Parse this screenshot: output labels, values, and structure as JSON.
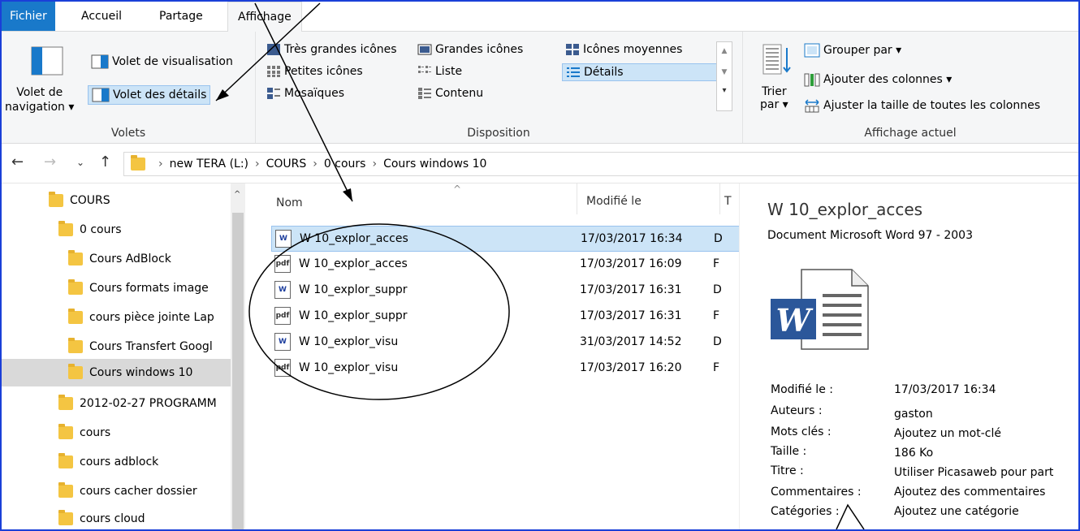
{
  "ribbon_tabs": [
    "Fichier",
    "Accueil",
    "Partage",
    "Affichage"
  ],
  "volets": {
    "nav_pane_line1": "Volet de",
    "nav_pane_line2": "navigation",
    "preview_pane": "Volet de visualisation",
    "details_pane": "Volet des détails",
    "group_label": "Volets"
  },
  "disposition": {
    "items": [
      "Très grandes icônes",
      "Grandes icônes",
      "Icônes moyennes",
      "Petites icônes",
      "Liste",
      "Détails",
      "Mosaïques",
      "Contenu"
    ],
    "group_label": "Disposition"
  },
  "affichage_actuel": {
    "sort_line1": "Trier",
    "sort_line2": "par",
    "group_by": "Grouper par",
    "add_columns": "Ajouter des colonnes",
    "fit_columns": "Ajuster la taille de toutes les colonnes",
    "group_label": "Affichage actuel"
  },
  "breadcrumb": [
    "new TERA (L:)",
    "COURS",
    "0 cours",
    "Cours windows 10"
  ],
  "nav_items": [
    {
      "label": "COURS",
      "indent": 0
    },
    {
      "label": "0 cours",
      "indent": 1
    },
    {
      "label": "Cours AdBlock",
      "indent": 2
    },
    {
      "label": "Cours formats image",
      "indent": 2
    },
    {
      "label": "cours pièce jointe Lap",
      "indent": 2
    },
    {
      "label": "Cours Transfert Googl",
      "indent": 2
    },
    {
      "label": "Cours windows 10",
      "indent": 2
    },
    {
      "label": "2012-02-27 PROGRAMM",
      "indent": 1
    },
    {
      "label": "cours",
      "indent": 1
    },
    {
      "label": "cours adblock",
      "indent": 1
    },
    {
      "label": "cours cacher dossier",
      "indent": 1
    },
    {
      "label": "cours cloud",
      "indent": 1
    }
  ],
  "list_columns": {
    "name": "Nom",
    "modified": "Modifié le",
    "type": "T"
  },
  "files": [
    {
      "name": "W 10_explor_acces",
      "modified": "17/03/2017 16:34",
      "type": "D",
      "icon": "word-doc-icon"
    },
    {
      "name": "W 10_explor_acces",
      "modified": "17/03/2017 16:09",
      "type": "F",
      "icon": "pdf-icon"
    },
    {
      "name": "W 10_explor_suppr",
      "modified": "17/03/2017 16:31",
      "type": "D",
      "icon": "word-doc-icon"
    },
    {
      "name": "W 10_explor_suppr",
      "modified": "17/03/2017 16:31",
      "type": "F",
      "icon": "pdf-icon"
    },
    {
      "name": "W 10_explor_visu",
      "modified": "31/03/2017 14:52",
      "type": "D",
      "icon": "word-doc-icon"
    },
    {
      "name": "W 10_explor_visu",
      "modified": "17/03/2017 16:20",
      "type": "F",
      "icon": "pdf-icon"
    }
  ],
  "details_pane": {
    "title": "W 10_explor_acces",
    "subtitle": "Document Microsoft Word 97 - 2003",
    "props": [
      {
        "label": "Modifié le :",
        "value": "17/03/2017 16:34"
      },
      {
        "label": "Auteurs :",
        "value": "gaston"
      },
      {
        "label": "Mots clés :",
        "value": "Ajoutez un mot-clé"
      },
      {
        "label": "Taille :",
        "value": "186 Ko"
      },
      {
        "label": "Titre :",
        "value": "Utiliser Picasaweb pour part"
      },
      {
        "label": "Commentaires :",
        "value": "Ajoutez des commentaires"
      },
      {
        "label": "Catégories :",
        "value": "Ajoutez une catégorie"
      }
    ]
  },
  "colors": {
    "selection": "#cce4f7",
    "file_tab": "#1979ca",
    "folder": "#f4c542",
    "frame": "#1a3fd8"
  }
}
